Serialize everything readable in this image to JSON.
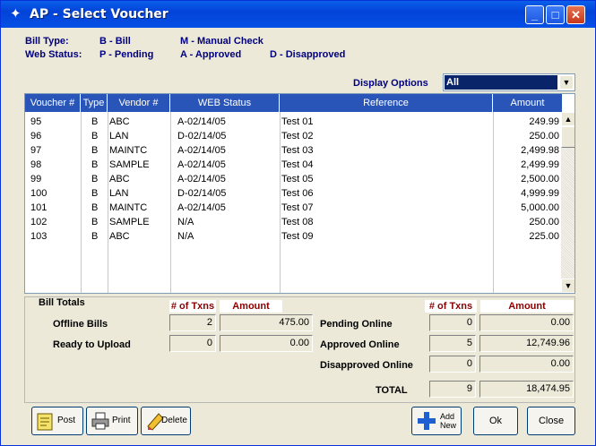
{
  "window": {
    "title": "AP - Select Voucher"
  },
  "legend": {
    "bill_type_label": "Bill Type:",
    "bill_type_b": "B - Bill",
    "bill_type_m": "M - Manual Check",
    "web_status_label": "Web Status:",
    "web_status_p": "P - Pending",
    "web_status_a": "A - Approved",
    "web_status_d": "D - Disapproved"
  },
  "display_options": {
    "label": "Display Options",
    "value": "All"
  },
  "grid": {
    "columns": [
      "Voucher #",
      "Type",
      "Vendor #",
      "WEB Status",
      "Reference",
      "Amount"
    ],
    "rows": [
      {
        "voucher": "95",
        "type": "B",
        "vendor": "ABC",
        "status": "A-02/14/05",
        "reference": "Test 01",
        "amount": "249.99"
      },
      {
        "voucher": "96",
        "type": "B",
        "vendor": "LAN",
        "status": "D-02/14/05",
        "reference": "Test 02",
        "amount": "250.00"
      },
      {
        "voucher": "97",
        "type": "B",
        "vendor": "MAINTC",
        "status": "A-02/14/05",
        "reference": "Test 03",
        "amount": "2,499.98"
      },
      {
        "voucher": "98",
        "type": "B",
        "vendor": "SAMPLE",
        "status": "A-02/14/05",
        "reference": "Test 04",
        "amount": "2,499.99"
      },
      {
        "voucher": "99",
        "type": "B",
        "vendor": "ABC",
        "status": "A-02/14/05",
        "reference": "Test 05",
        "amount": "2,500.00"
      },
      {
        "voucher": "100",
        "type": "B",
        "vendor": "LAN",
        "status": "D-02/14/05",
        "reference": "Test 06",
        "amount": "4,999.99"
      },
      {
        "voucher": "101",
        "type": "B",
        "vendor": "MAINTC",
        "status": "A-02/14/05",
        "reference": "Test 07",
        "amount": "5,000.00"
      },
      {
        "voucher": "102",
        "type": "B",
        "vendor": "SAMPLE",
        "status": "N/A",
        "reference": "Test 08",
        "amount": "250.00"
      },
      {
        "voucher": "103",
        "type": "B",
        "vendor": "ABC",
        "status": "N/A",
        "reference": "Test 09",
        "amount": "225.00"
      }
    ]
  },
  "totals": {
    "title": "Bill Totals",
    "txns_header": "# of Txns",
    "amount_header": "Amount",
    "offline_label": "Offline Bills",
    "offline_txns": "2",
    "offline_amount": "475.00",
    "ready_label": "Ready to Upload",
    "ready_txns": "0",
    "ready_amount": "0.00",
    "pending_label": "Pending Online",
    "pending_txns": "0",
    "pending_amount": "0.00",
    "approved_label": "Approved Online",
    "approved_txns": "5",
    "approved_amount": "12,749.96",
    "disapproved_label": "Disapproved Online",
    "disapproved_txns": "0",
    "disapproved_amount": "0.00",
    "total_label": "TOTAL",
    "total_txns": "9",
    "total_amount": "18,474.95"
  },
  "buttons": {
    "post": "Post",
    "print": "Print",
    "delete": "Delete",
    "add_new_line1": "Add",
    "add_new_line2": "New",
    "ok": "Ok",
    "close": "Close"
  },
  "colors": {
    "title_bar": "#0550e6",
    "grid_header": "#2a55b8",
    "legend_text": "#000080",
    "totals_header": "#8b0000"
  }
}
